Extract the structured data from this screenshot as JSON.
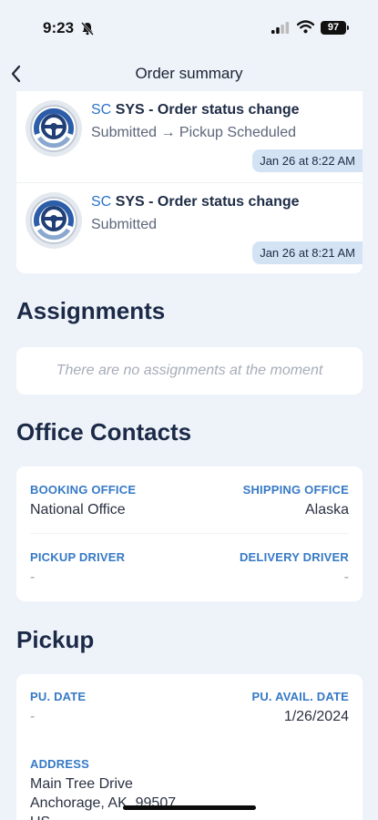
{
  "status_bar": {
    "time": "9:23",
    "battery": "97"
  },
  "nav": {
    "title": "Order summary"
  },
  "history": [
    {
      "prefix": "SC",
      "title": "SYS - Order status change",
      "description": "Submitted → Pickup Scheduled",
      "timestamp": "Jan 26 at 8:22 AM"
    },
    {
      "prefix": "SC",
      "title": "SYS - Order status change",
      "description": "Submitted",
      "timestamp": "Jan 26 at 8:21 AM"
    }
  ],
  "assignments": {
    "title": "Assignments",
    "empty": "There are no assignments at the moment"
  },
  "office_contacts": {
    "title": "Office Contacts",
    "booking_office_label": "BOOKING OFFICE",
    "booking_office_value": "National Office",
    "shipping_office_label": "SHIPPING OFFICE",
    "shipping_office_value": "Alaska",
    "pickup_driver_label": "PICKUP DRIVER",
    "pickup_driver_value": "-",
    "delivery_driver_label": "DELIVERY DRIVER",
    "delivery_driver_value": "-"
  },
  "pickup": {
    "title": "Pickup",
    "date_label": "PU. DATE",
    "date_value": "-",
    "avail_date_label": "PU. AVAIL. DATE",
    "avail_date_value": "1/26/2024",
    "address_label": "ADDRESS",
    "address_line1": "Main Tree Drive",
    "address_line2": "Anchorage, AK, 99507",
    "address_line3": "US"
  },
  "colors": {
    "accent": "#3679c6",
    "background": "#eef2f9",
    "timestamp_pill": "#d4e3f4",
    "heading": "#1b2a47"
  }
}
